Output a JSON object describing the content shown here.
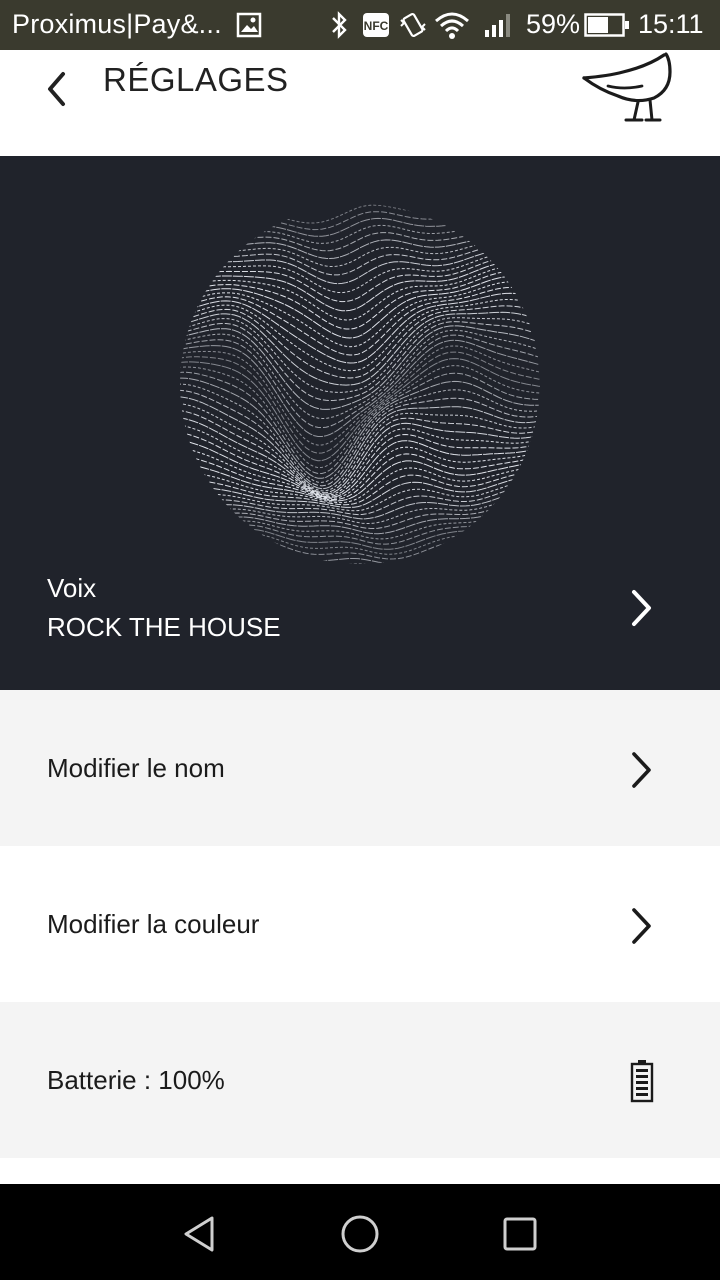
{
  "status_bar": {
    "carrier": "Proximus|Pay&...",
    "battery_percent": "59%",
    "time": "15:11",
    "icons": [
      "image-icon",
      "bluetooth-icon",
      "nfc-icon",
      "vibrate-icon",
      "wifi-icon",
      "signal-icon",
      "battery-icon"
    ]
  },
  "header": {
    "title": "RÉGLAGES",
    "back_icon": "chevron-left-icon",
    "logo_icon": "bird-logo"
  },
  "hero": {
    "voice_label": "Voix",
    "voice_value": "ROCK THE HOUSE",
    "background": "#20232b"
  },
  "settings": {
    "rename_label": "Modifier le nom",
    "color_label": "Modifier la couleur",
    "battery_label": "Batterie : 100%",
    "battery_level": 1.0
  },
  "nav": {
    "icons": [
      "back-triangle-icon",
      "home-circle-icon",
      "recents-square-icon"
    ]
  }
}
